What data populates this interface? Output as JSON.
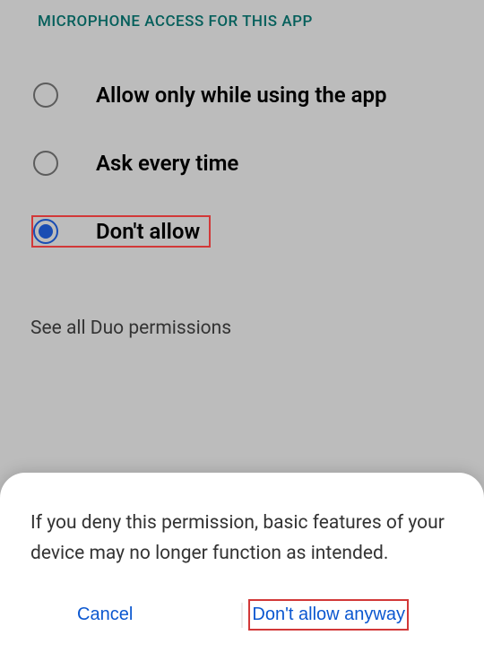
{
  "header": {
    "title": "MICROPHONE ACCESS FOR THIS APP"
  },
  "options": [
    {
      "label": "Allow only while using the app",
      "selected": false
    },
    {
      "label": "Ask every time",
      "selected": false
    },
    {
      "label": "Don't allow",
      "selected": true
    }
  ],
  "seeAll": "See all Duo permissions",
  "sheet": {
    "message": "If you deny this permission, basic features of your device may no longer function as intended.",
    "cancel": "Cancel",
    "confirm": "Don't allow anyway"
  }
}
